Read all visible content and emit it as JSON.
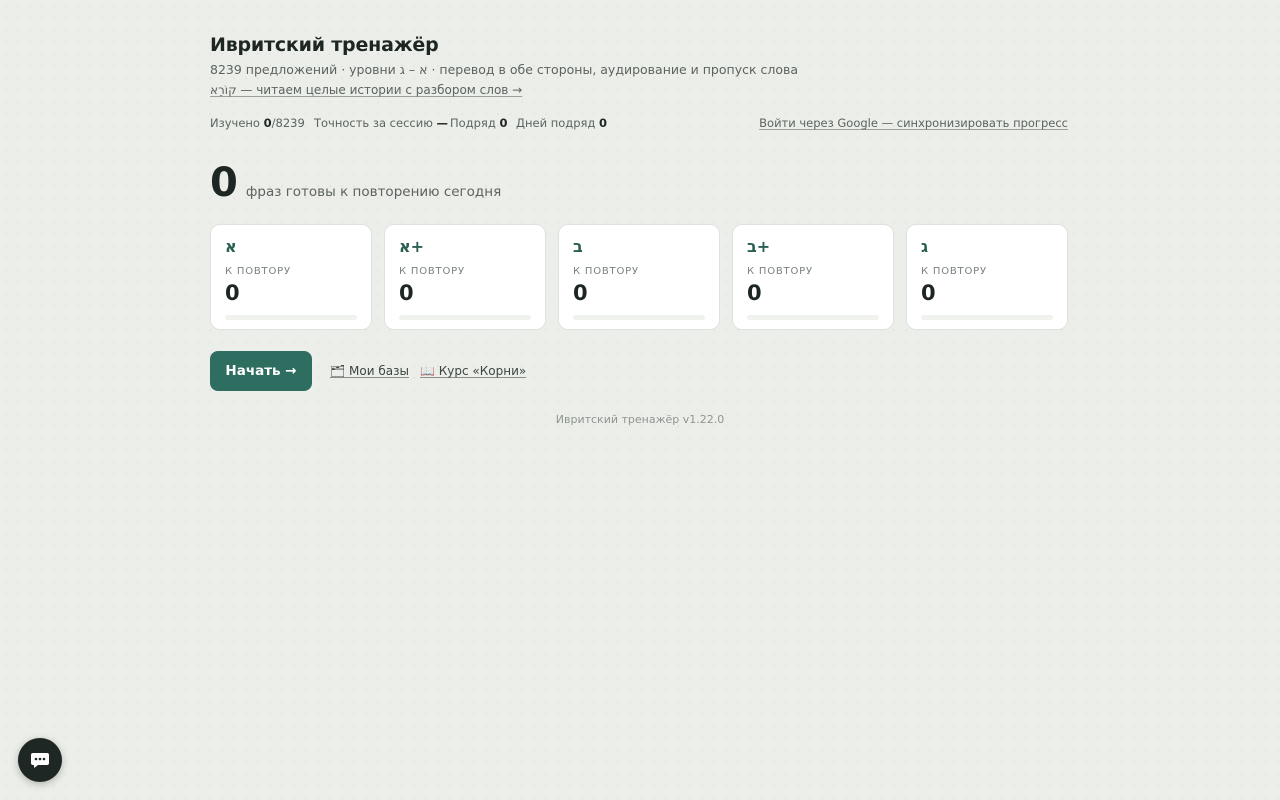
{
  "app": {
    "title": "Ивритский тренажёр",
    "subtitle": "8239 предложений · уровни א – ג · перевод в обе стороны, аудирование и пропуск слова",
    "kora_link": "קוֹרֵא — читаем целые истории с разбором слов →"
  },
  "stats": {
    "studied_label": "Изучено",
    "studied_value": "0",
    "studied_total": "/8239",
    "accuracy_label": "Точность за сессию",
    "accuracy_value": "—",
    "streak_label": "Подряд",
    "streak_value": "0",
    "days_label": "Дней подряд",
    "days_value": "0",
    "google_login": "Войти через Google — синхронизировать прогресс"
  },
  "due": {
    "count": "0",
    "label": "фраз готовы к повторению сегодня"
  },
  "levels": [
    {
      "level": "א",
      "label": "К ПОВТОРУ",
      "value": "0",
      "progress": 0
    },
    {
      "level": "א+",
      "label": "К ПОВТОРУ",
      "value": "0",
      "progress": 0
    },
    {
      "level": "ב",
      "label": "К ПОВТОРУ",
      "value": "0",
      "progress": 0
    },
    {
      "level": "ב+",
      "label": "К ПОВТОРУ",
      "value": "0",
      "progress": 0
    },
    {
      "level": "ג",
      "label": "К ПОВТОРУ",
      "value": "0",
      "progress": 0
    }
  ],
  "actions": {
    "start": "Начать →",
    "my_bases": "🗂 Мои базы",
    "roots_course": "📖 Курс «Корни»"
  },
  "footer": {
    "version": "Ивритский тренажёр v1.22.0"
  },
  "chat": {
    "icon": "chat-bubble-icon"
  },
  "colors": {
    "accent": "#2d6e61",
    "background": "#eceee9",
    "level_text": "#2a5f53"
  }
}
